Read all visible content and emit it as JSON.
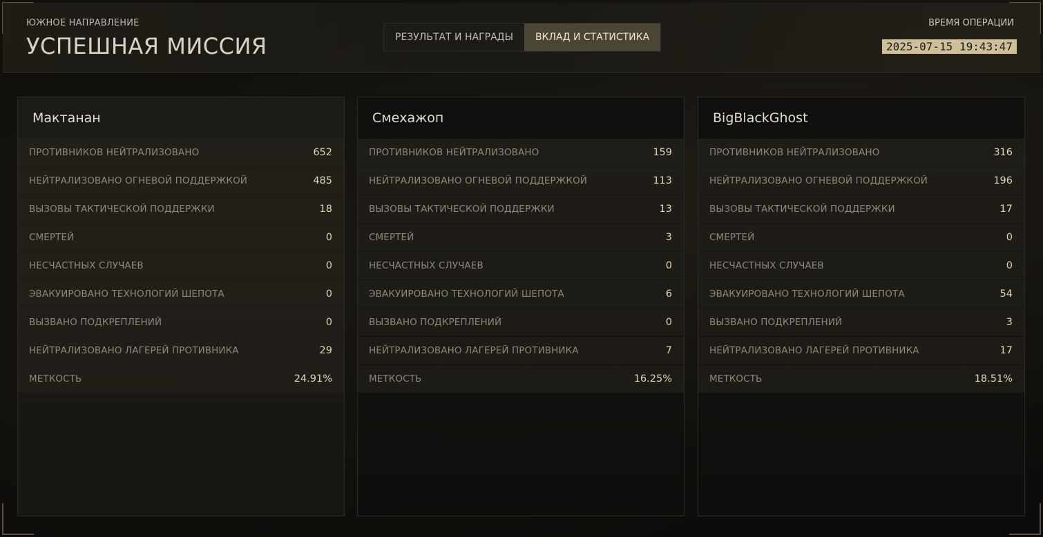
{
  "header": {
    "region": "ЮЖНОЕ НАПРАВЛЕНИЕ",
    "title": "УСПЕШНАЯ МИССИЯ",
    "op_time_label": "ВРЕМЯ ОПЕРАЦИИ",
    "op_time_value": "2025-07-15 19:43:47"
  },
  "tabs": [
    {
      "label": "РЕЗУЛЬТАТ И НАГРАДЫ",
      "active": false
    },
    {
      "label": "ВКЛАД И СТАТИСТИКА",
      "active": true
    }
  ],
  "stat_labels": [
    "ПРОТИВНИКОВ НЕЙТРАЛИЗОВАНО",
    "НЕЙТРАЛИЗОВАНО ОГНЕВОЙ ПОДДЕРЖКОЙ",
    "ВЫЗОВЫ ТАКТИЧЕСКОЙ ПОДДЕРЖКИ",
    "СМЕРТЕЙ",
    "НЕСЧАСТНЫХ СЛУЧАЕВ",
    "ЭВАКУИРОВАНО ТЕХНОЛОГИЙ ШЕПОТА",
    "ВЫЗВАНО ПОДКРЕПЛЕНИЙ",
    "НЕЙТРАЛИЗОВАНО ЛАГЕРЕЙ ПРОТИВНИКА",
    "МЕТКОСТЬ"
  ],
  "players": [
    {
      "name": "Мактанан",
      "values": [
        "652",
        "485",
        "18",
        "0",
        "0",
        "0",
        "0",
        "29",
        "24.91%"
      ]
    },
    {
      "name": "Смехажоп",
      "values": [
        "159",
        "113",
        "13",
        "3",
        "0",
        "6",
        "0",
        "7",
        "16.25%"
      ]
    },
    {
      "name": "BigBlackGhost",
      "values": [
        "316",
        "196",
        "17",
        "0",
        "0",
        "54",
        "3",
        "17",
        "18.51%"
      ]
    }
  ]
}
